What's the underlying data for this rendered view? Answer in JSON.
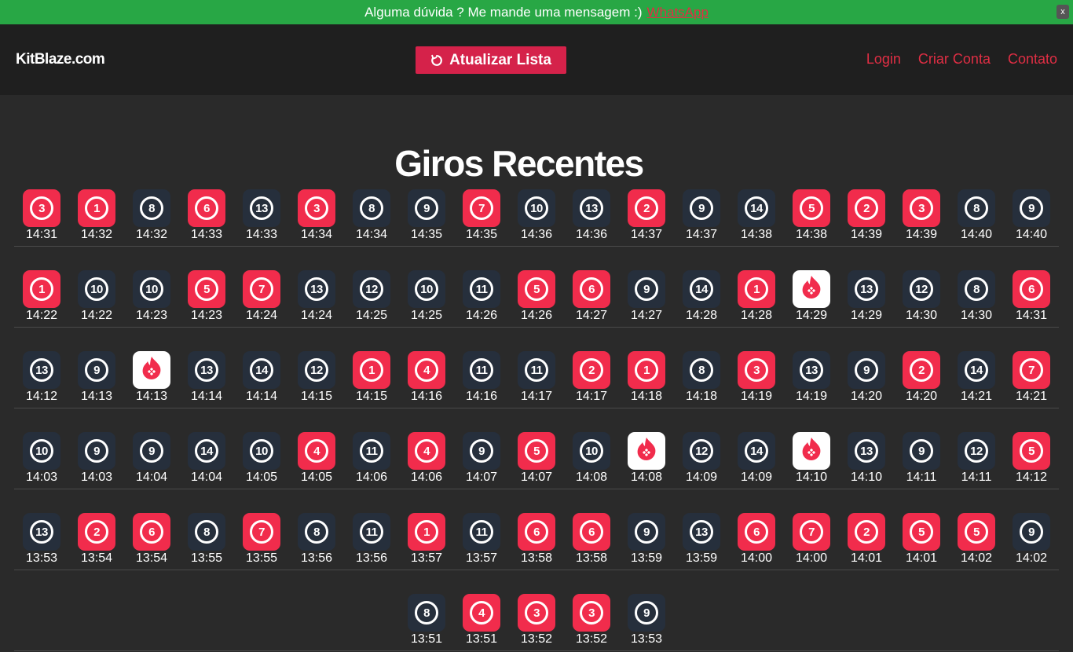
{
  "banner": {
    "text": "Alguma dúvida ? Me mande uma mensagem :)",
    "link": "WhatsApp",
    "close": "x"
  },
  "nav": {
    "brand": "KitBlaze.com",
    "refresh": "Atualizar Lista",
    "links": [
      "Login",
      "Criar Conta",
      "Contato"
    ]
  },
  "title": "Giros Recentes",
  "colors": {
    "red": "#f12c4c",
    "black": "#262f3c",
    "white": "#ffffff",
    "accent": "#e02e44",
    "banner": "#28a745"
  },
  "rows": [
    [
      [
        "3",
        "14:31"
      ],
      [
        "1",
        "14:32"
      ],
      [
        "8",
        "14:32"
      ],
      [
        "6",
        "14:33"
      ],
      [
        "13",
        "14:33"
      ],
      [
        "3",
        "14:34"
      ],
      [
        "8",
        "14:34"
      ],
      [
        "9",
        "14:35"
      ],
      [
        "7",
        "14:35"
      ],
      [
        "10",
        "14:36"
      ],
      [
        "13",
        "14:36"
      ],
      [
        "2",
        "14:37"
      ],
      [
        "9",
        "14:37"
      ],
      [
        "14",
        "14:38"
      ],
      [
        "5",
        "14:38"
      ],
      [
        "2",
        "14:39"
      ],
      [
        "3",
        "14:39"
      ],
      [
        "8",
        "14:40"
      ],
      [
        "9",
        "14:40"
      ]
    ],
    [
      [
        "1",
        "14:22"
      ],
      [
        "10",
        "14:22"
      ],
      [
        "10",
        "14:23"
      ],
      [
        "5",
        "14:23"
      ],
      [
        "7",
        "14:24"
      ],
      [
        "13",
        "14:24"
      ],
      [
        "12",
        "14:25"
      ],
      [
        "10",
        "14:25"
      ],
      [
        "11",
        "14:26"
      ],
      [
        "5",
        "14:26"
      ],
      [
        "6",
        "14:27"
      ],
      [
        "9",
        "14:27"
      ],
      [
        "14",
        "14:28"
      ],
      [
        "1",
        "14:28"
      ],
      [
        "0",
        "14:29"
      ],
      [
        "13",
        "14:29"
      ],
      [
        "12",
        "14:30"
      ],
      [
        "8",
        "14:30"
      ],
      [
        "6",
        "14:31"
      ]
    ],
    [
      [
        "13",
        "14:12"
      ],
      [
        "9",
        "14:13"
      ],
      [
        "0",
        "14:13"
      ],
      [
        "13",
        "14:14"
      ],
      [
        "14",
        "14:14"
      ],
      [
        "12",
        "14:15"
      ],
      [
        "1",
        "14:15"
      ],
      [
        "4",
        "14:16"
      ],
      [
        "11",
        "14:16"
      ],
      [
        "11",
        "14:17"
      ],
      [
        "2",
        "14:17"
      ],
      [
        "1",
        "14:18"
      ],
      [
        "8",
        "14:18"
      ],
      [
        "3",
        "14:19"
      ],
      [
        "13",
        "14:19"
      ],
      [
        "9",
        "14:20"
      ],
      [
        "2",
        "14:20"
      ],
      [
        "14",
        "14:21"
      ],
      [
        "7",
        "14:21"
      ]
    ],
    [
      [
        "10",
        "14:03"
      ],
      [
        "9",
        "14:03"
      ],
      [
        "9",
        "14:04"
      ],
      [
        "14",
        "14:04"
      ],
      [
        "10",
        "14:05"
      ],
      [
        "4",
        "14:05"
      ],
      [
        "11",
        "14:06"
      ],
      [
        "4",
        "14:06"
      ],
      [
        "9",
        "14:07"
      ],
      [
        "5",
        "14:07"
      ],
      [
        "10",
        "14:08"
      ],
      [
        "0",
        "14:08"
      ],
      [
        "12",
        "14:09"
      ],
      [
        "14",
        "14:09"
      ],
      [
        "0",
        "14:10"
      ],
      [
        "13",
        "14:10"
      ],
      [
        "9",
        "14:11"
      ],
      [
        "12",
        "14:11"
      ],
      [
        "5",
        "14:12"
      ]
    ],
    [
      [
        "13",
        "13:53"
      ],
      [
        "2",
        "13:54"
      ],
      [
        "6",
        "13:54"
      ],
      [
        "8",
        "13:55"
      ],
      [
        "7",
        "13:55"
      ],
      [
        "8",
        "13:56"
      ],
      [
        "11",
        "13:56"
      ],
      [
        "1",
        "13:57"
      ],
      [
        "11",
        "13:57"
      ],
      [
        "6",
        "13:58"
      ],
      [
        "6",
        "13:58"
      ],
      [
        "9",
        "13:59"
      ],
      [
        "13",
        "13:59"
      ],
      [
        "6",
        "14:00"
      ],
      [
        "7",
        "14:00"
      ],
      [
        "2",
        "14:01"
      ],
      [
        "5",
        "14:01"
      ],
      [
        "5",
        "14:02"
      ],
      [
        "9",
        "14:02"
      ]
    ],
    [
      [
        "8",
        "13:51"
      ],
      [
        "4",
        "13:51"
      ],
      [
        "3",
        "13:52"
      ],
      [
        "3",
        "13:52"
      ],
      [
        "9",
        "13:53"
      ]
    ]
  ]
}
